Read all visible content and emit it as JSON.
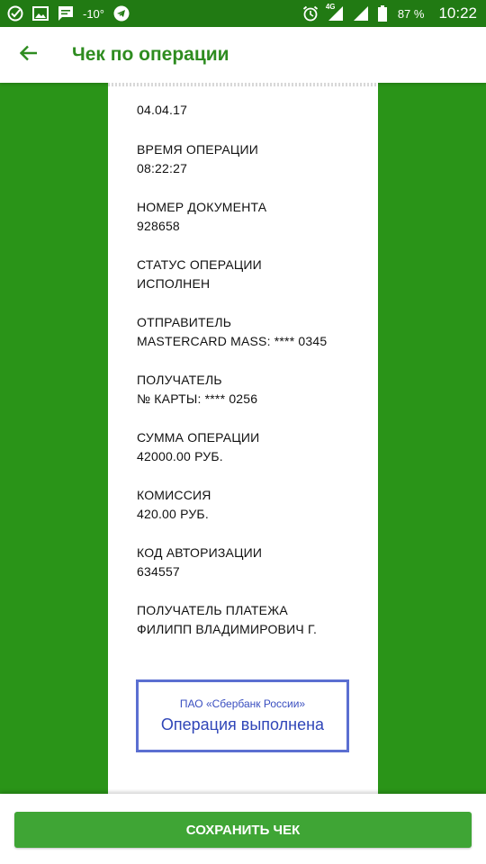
{
  "status_bar": {
    "temperature": "-10°",
    "battery_percent": "87 %",
    "time": "10:22",
    "network": "4G",
    "icons": [
      "sberbank-icon",
      "image-icon",
      "message-icon",
      "telegram-icon",
      "alarm-icon",
      "signal-icon",
      "battery-icon"
    ]
  },
  "app_bar": {
    "title": "Чек по операции",
    "back_icon": "arrow-left-icon"
  },
  "receipt": {
    "date": "04.04.17",
    "fields": [
      {
        "label": "ВРЕМЯ ОПЕРАЦИИ",
        "value": "08:22:27"
      },
      {
        "label": "НОМЕР ДОКУМЕНТА",
        "value": "928658"
      },
      {
        "label": "СТАТУС ОПЕРАЦИИ",
        "value": "ИСПОЛНЕН"
      },
      {
        "label": "ОТПРАВИТЕЛЬ",
        "value": "MASTERCARD MASS: **** 0345"
      },
      {
        "label": "ПОЛУЧАТЕЛЬ",
        "value": "№ КАРТЫ: **** 0256"
      },
      {
        "label": "СУММА ОПЕРАЦИИ",
        "value": "42000.00 РУБ."
      },
      {
        "label": "КОМИССИЯ",
        "value": "420.00 РУБ."
      },
      {
        "label": "КОД АВТОРИЗАЦИИ",
        "value": "634557"
      },
      {
        "label": "ПОЛУЧАТЕЛЬ ПЛАТЕЖА",
        "value": "ФИЛИПП ВЛАДИМИРОВИЧ Г."
      }
    ],
    "stamp": {
      "bank": "ПАО «Сбербанк России»",
      "status": "Операция выполнена"
    }
  },
  "actions": {
    "save_label": "СОХРАНИТЬ ЧЕК"
  },
  "colors": {
    "brand_green": "#2a9418",
    "status_bar": "#217a13",
    "button_green": "#3fa535",
    "stamp_blue": "#3046b8"
  }
}
